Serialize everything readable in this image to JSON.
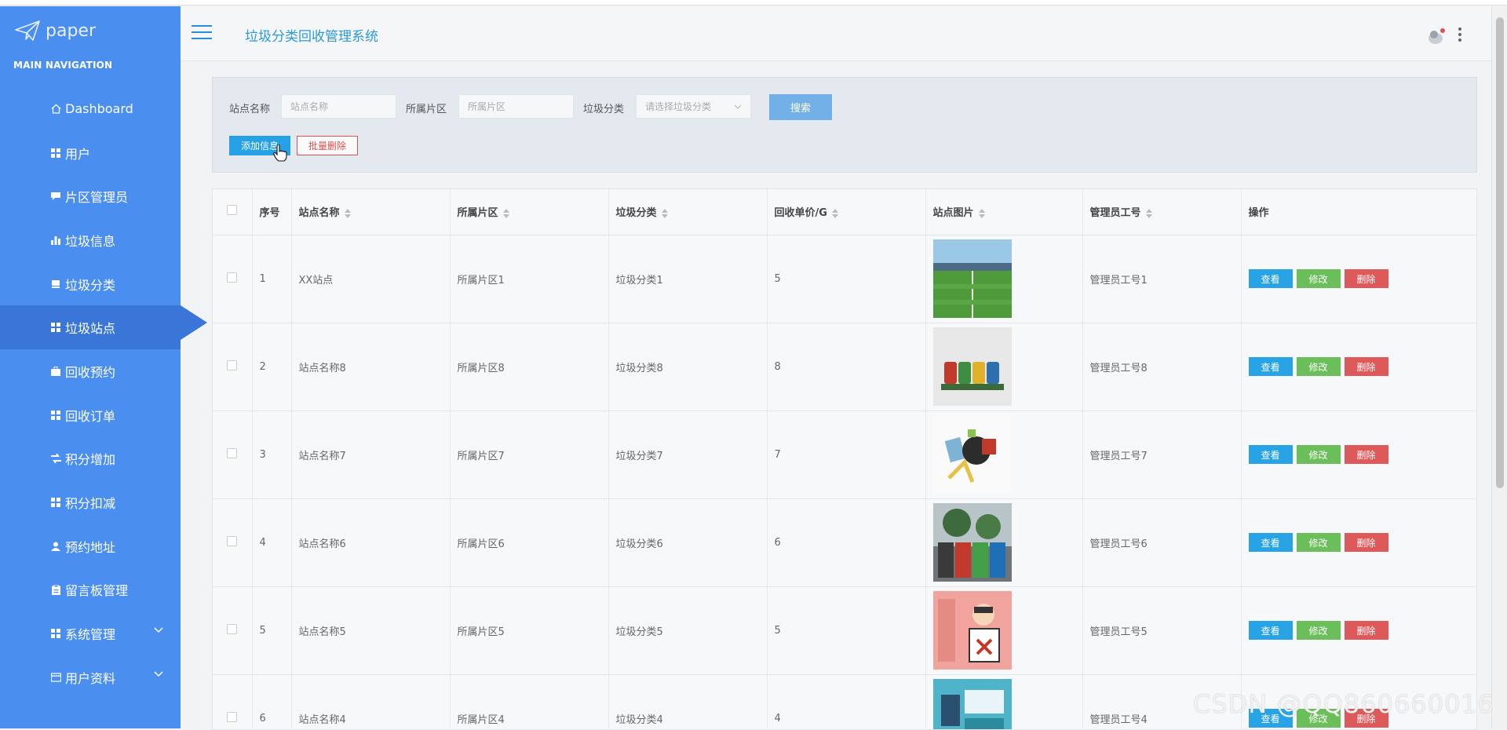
{
  "brand": {
    "name": "paper"
  },
  "sidebar": {
    "heading": "MAIN NAVIGATION",
    "items": [
      {
        "label": "Dashboard",
        "icon": "home-icon"
      },
      {
        "label": "用户",
        "icon": "grid-icon"
      },
      {
        "label": "片区管理员",
        "icon": "comment-icon"
      },
      {
        "label": "垃圾信息",
        "icon": "bar-chart-icon"
      },
      {
        "label": "垃圾分类",
        "icon": "hdd-icon"
      },
      {
        "label": "垃圾站点",
        "icon": "grid-icon"
      },
      {
        "label": "回收预约",
        "icon": "briefcase-icon"
      },
      {
        "label": "回收订单",
        "icon": "grid-icon"
      },
      {
        "label": "积分增加",
        "icon": "transfer-icon"
      },
      {
        "label": "积分扣减",
        "icon": "grid-icon"
      },
      {
        "label": "预约地址",
        "icon": "user-icon"
      },
      {
        "label": "留言板管理",
        "icon": "clipboard-icon"
      },
      {
        "label": "系统管理",
        "icon": "grid-icon"
      },
      {
        "label": "用户资料",
        "icon": "card-icon"
      }
    ],
    "active_index": 5
  },
  "header": {
    "title": "垃圾分类回收管理系统"
  },
  "search": {
    "site_name_label": "站点名称",
    "site_name_placeholder": "站点名称",
    "district_label": "所属片区",
    "district_placeholder": "所属片区",
    "category_label": "垃圾分类",
    "category_placeholder": "请选择垃圾分类",
    "search_button": "搜索",
    "add_button": "添加信息",
    "batch_delete_button": "批量删除"
  },
  "table": {
    "columns": [
      "序号",
      "站点名称",
      "所属片区",
      "垃圾分类",
      "回收单价/G",
      "站点图片",
      "管理员工号",
      "操作"
    ],
    "actions": {
      "view": "查看",
      "edit": "修改",
      "delete": "删除"
    },
    "rows": [
      {
        "index": "1",
        "site": "XX站点",
        "district": "所属片区1",
        "category": "垃圾分类1",
        "price": "5",
        "image": "football-field",
        "admin": "管理员工号1"
      },
      {
        "index": "2",
        "site": "站点名称8",
        "district": "所属片区8",
        "category": "垃圾分类8",
        "price": "8",
        "image": "four-bins",
        "admin": "管理员工号8"
      },
      {
        "index": "3",
        "site": "站点名称7",
        "district": "所属片区7",
        "category": "垃圾分类7",
        "price": "7",
        "image": "cartoon-trash",
        "admin": "管理员工号7"
      },
      {
        "index": "4",
        "site": "站点名称6",
        "district": "所属片区6",
        "category": "垃圾分类6",
        "price": "6",
        "image": "street-bins",
        "admin": "管理员工号6"
      },
      {
        "index": "5",
        "site": "站点名称5",
        "district": "所属片区5",
        "category": "垃圾分类5",
        "price": "5",
        "image": "hazard-poster",
        "admin": "管理员工号5"
      },
      {
        "index": "6",
        "site": "站点名称4",
        "district": "所属片区4",
        "category": "垃圾分类4",
        "price": "4",
        "image": "bins-poster",
        "admin": "管理员工号4"
      }
    ]
  },
  "watermark": "CSDN @QQ860660016",
  "colors": {
    "sidebar": "#4a8ef0",
    "active": "#3a76d8",
    "view": "#28a3e5",
    "edit": "#6bbf5a",
    "delete": "#de5a5a",
    "title": "#2b9ad8"
  }
}
